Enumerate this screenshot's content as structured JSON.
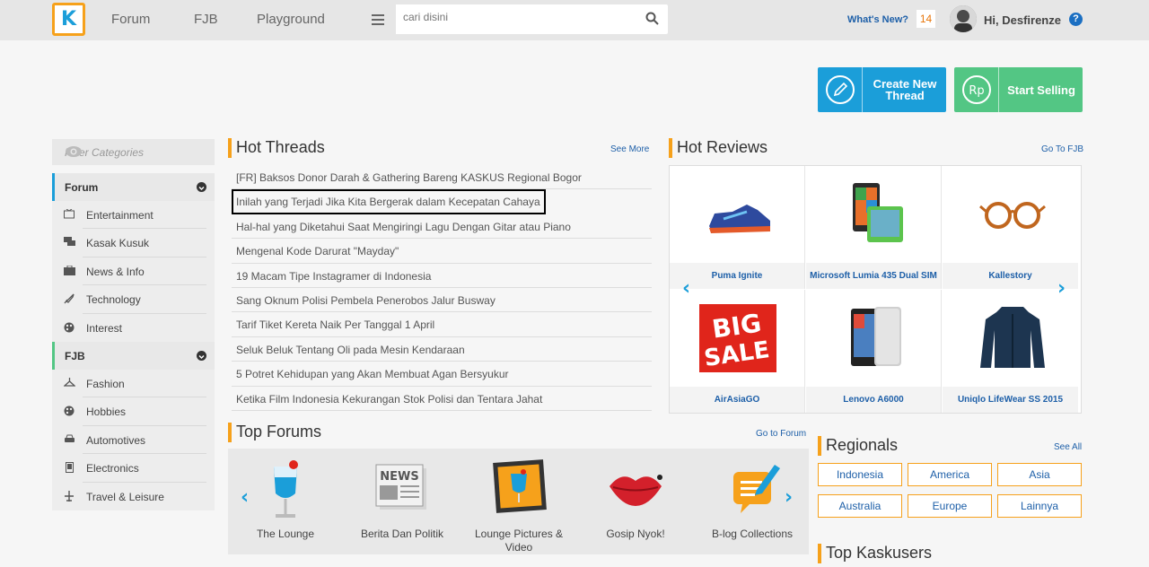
{
  "header": {
    "logo": "K",
    "nav": [
      "Forum",
      "FJB",
      "Playground"
    ],
    "search_placeholder": "cari disini",
    "whats_new": "What's New?",
    "notif_count": "14",
    "greeting": "Hi, Desfirenze",
    "help": "?"
  },
  "actions": {
    "create_thread": "Create New Thread",
    "start_selling": "Start Selling",
    "rp": "Rp"
  },
  "sidebar": {
    "filter_placeholder": "Filter Categories",
    "forum_label": "Forum",
    "forum_items": [
      "Entertainment",
      "Kasak Kusuk",
      "News & Info",
      "Technology",
      "Interest"
    ],
    "fjb_label": "FJB",
    "fjb_items": [
      "Fashion",
      "Hobbies",
      "Automotives",
      "Electronics",
      "Travel & Leisure"
    ]
  },
  "hot_threads": {
    "title": "Hot Threads",
    "link": "See More",
    "items": [
      "[FR] Baksos Donor Darah & Gathering Bareng KASKUS Regional Bogor",
      "Inilah yang Terjadi Jika Kita Bergerak dalam Kecepatan Cahaya",
      "Hal-hal yang Diketahui Saat Mengiringi Lagu Dengan Gitar atau Piano",
      "Mengenal Kode Darurat \"Mayday\"",
      "19 Macam Tipe Instagramer di Indonesia",
      "Sang Oknum Polisi Pembela Penerobos Jalur Busway",
      "Tarif Tiket Kereta Naik Per Tanggal 1 April",
      "Seluk Beluk Tentang Oli pada Mesin Kendaraan",
      "5 Potret Kehidupan yang Akan Membuat Agan Bersyukur",
      "Ketika Film Indonesia Kekurangan Stok Polisi dan Tentara Jahat"
    ]
  },
  "hot_reviews": {
    "title": "Hot Reviews",
    "link": "Go To FJB",
    "items": [
      "Puma Ignite",
      "Microsoft Lumia 435 Dual SIM",
      "Kallestory",
      "AirAsiaGO",
      "Lenovo A6000",
      "Uniqlo LifeWear SS 2015"
    ],
    "big_sale_1": "BIG",
    "big_sale_2": "SALE"
  },
  "top_forums": {
    "title": "Top Forums",
    "link": "Go to Forum",
    "items": [
      "The Lounge",
      "Berita Dan Politik",
      "Lounge Pictures & Video",
      "Gosip Nyok!",
      "B-log Collections"
    ],
    "news_icon_text": "NEWS"
  },
  "regionals": {
    "title": "Regionals",
    "link": "See All",
    "items": [
      "Indonesia",
      "America",
      "Asia",
      "Australia",
      "Europe",
      "Lainnya"
    ]
  },
  "top_kaskusers": {
    "title": "Top Kaskusers"
  },
  "colors": {
    "accent": "#1b9ed9",
    "orange": "#f6a11b",
    "green": "#53c684",
    "link": "#1d5fa8"
  }
}
